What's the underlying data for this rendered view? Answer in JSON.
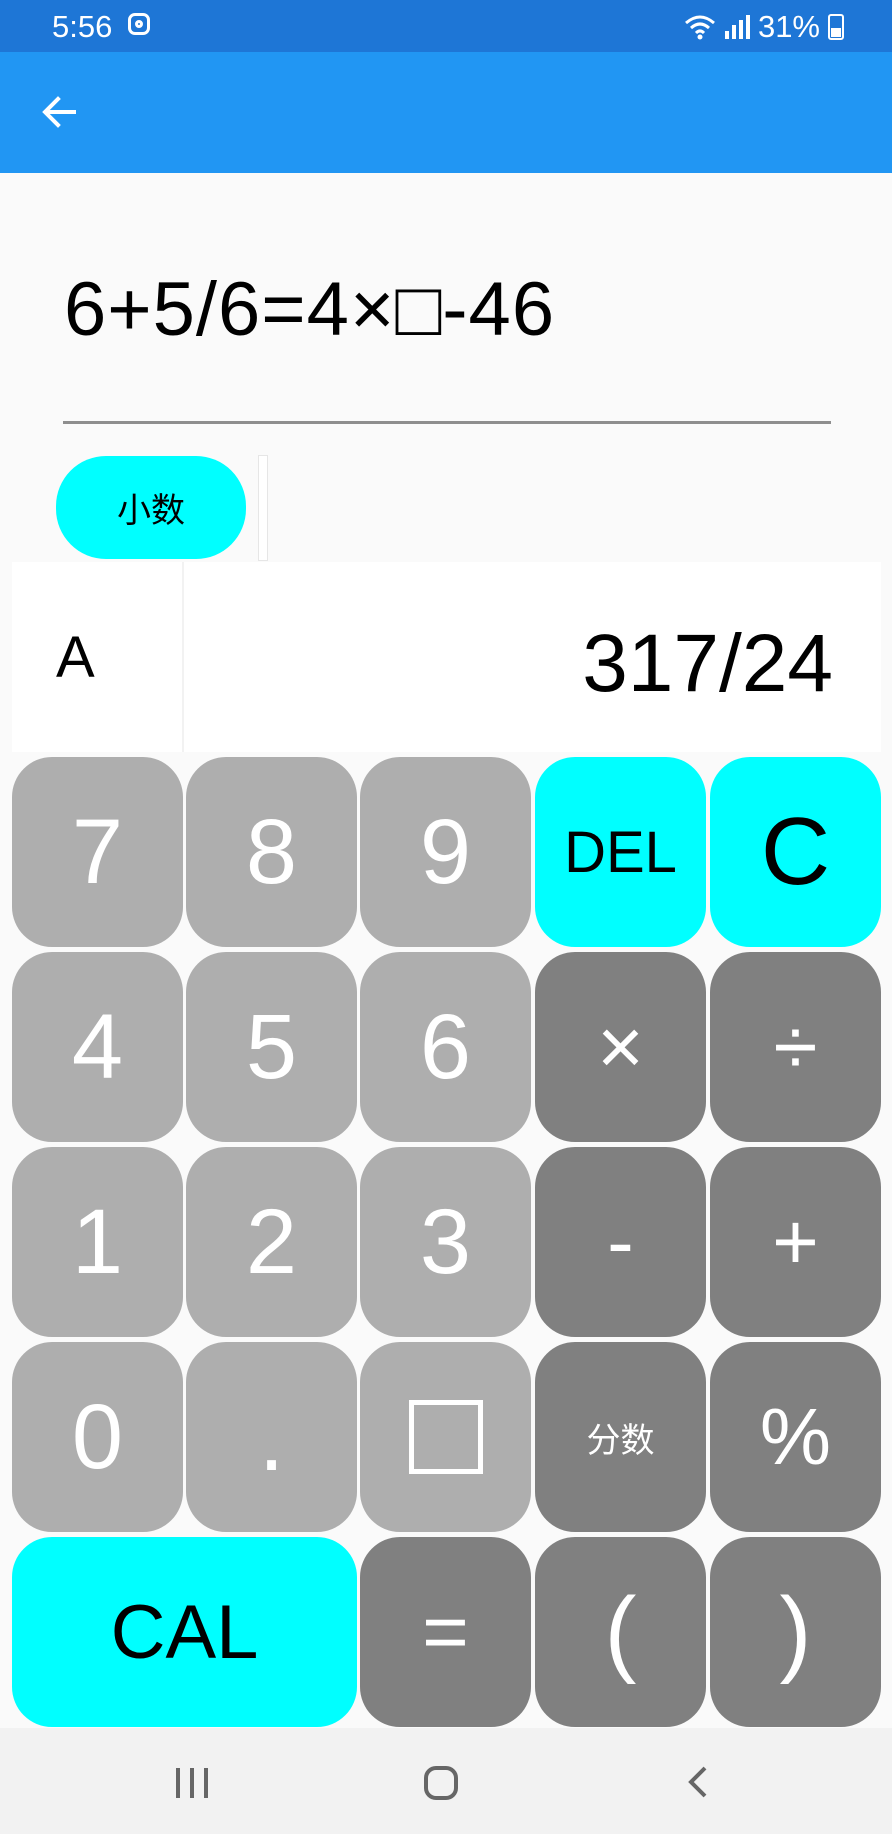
{
  "status": {
    "time": "5:56",
    "battery": "31%",
    "icons": [
      "instagram-icon",
      "wifi-icon",
      "signal-icon",
      "battery-icon"
    ]
  },
  "app_bar": {
    "back_icon": "arrow-left-icon"
  },
  "equation": {
    "text": "6+5/6=4×□-46"
  },
  "mode_button": {
    "label": "小数"
  },
  "result": {
    "label": "A",
    "value": "317/24"
  },
  "keys": {
    "seven": "7",
    "eight": "8",
    "nine": "9",
    "del": "DEL",
    "clear": "C",
    "four": "4",
    "five": "5",
    "six": "6",
    "multiply": "×",
    "divide": "÷",
    "one": "1",
    "two": "2",
    "three": "3",
    "minus": "-",
    "plus": "+",
    "zero": "0",
    "dot": ".",
    "fraction": "分数",
    "percent": "%",
    "cal": "CAL",
    "equals": "=",
    "lparen": "(",
    "rparen": ")"
  },
  "colors": {
    "status_bar": "#1e76d6",
    "app_bar": "#2196f3",
    "accent": "#00ffff",
    "number_key": "#aeaeae",
    "operator_key": "#808080"
  }
}
